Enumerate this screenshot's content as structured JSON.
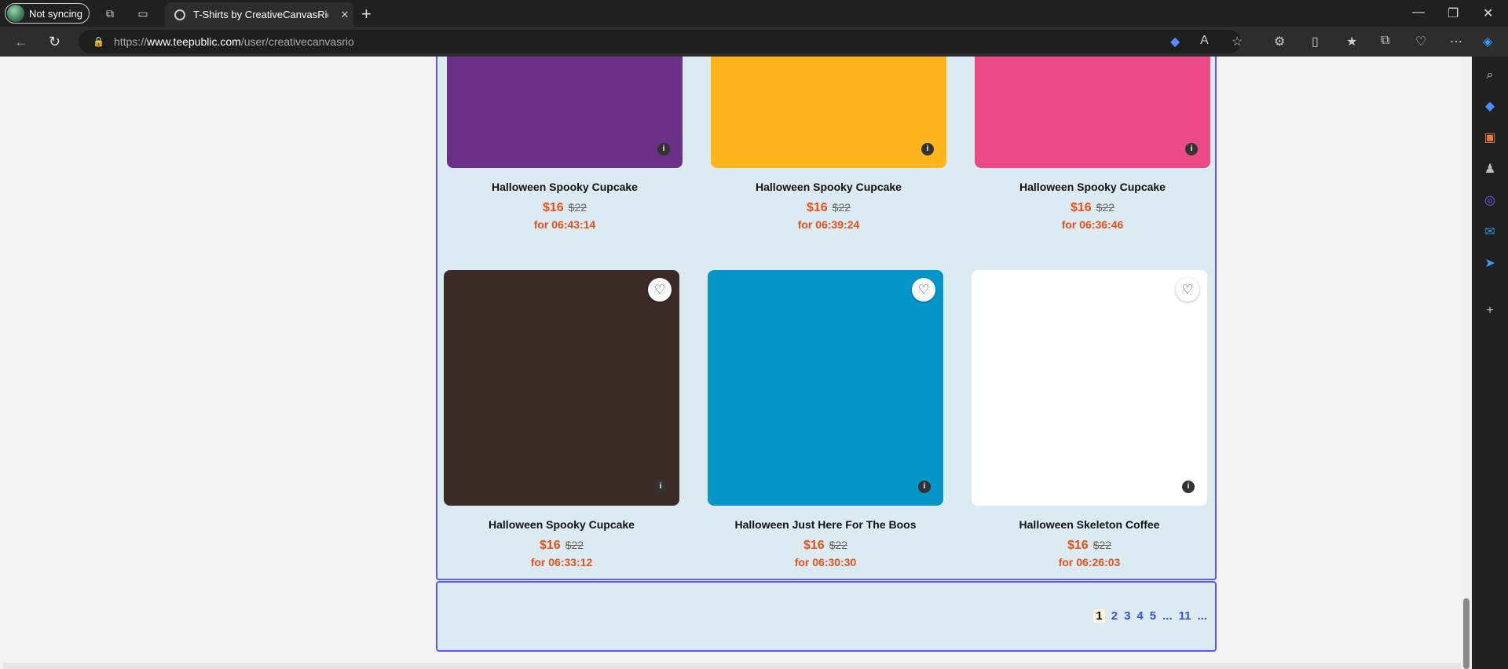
{
  "browser": {
    "profile_label": "Not syncing",
    "tab_title": "T-Shirts by CreativeCanvasRio | T",
    "url_prefix": "https://",
    "url_host": "www.teepublic.com",
    "url_path": "/user/creativecanvasrio"
  },
  "products": [
    {
      "title": "Halloween Spooky Cupcake",
      "price": "$16",
      "old_price": "$22",
      "timer": "for 06:43:14",
      "bg": "#6a2f86"
    },
    {
      "title": "Halloween Spooky Cupcake",
      "price": "$16",
      "old_price": "$22",
      "timer": "for 06:39:24",
      "bg": "#fdb51d"
    },
    {
      "title": "Halloween Spooky Cupcake",
      "price": "$16",
      "old_price": "$22",
      "timer": "for 06:36:46",
      "bg": "#ec4a86"
    },
    {
      "title": "Halloween Spooky Cupcake",
      "price": "$16",
      "old_price": "$22",
      "timer": "for 06:33:12",
      "bg": "#3b2b26"
    },
    {
      "title": "Halloween Just Here For The Boos",
      "price": "$16",
      "old_price": "$22",
      "timer": "for 06:30:30",
      "bg": "#0496c8"
    },
    {
      "title": "Halloween Skeleton Coffee",
      "price": "$16",
      "old_price": "$22",
      "timer": "for 06:26:03",
      "bg": "#ffffff"
    }
  ],
  "pagination": [
    "1",
    "2",
    "3",
    "4",
    "5",
    "...",
    "11",
    "..."
  ],
  "colors": {
    "accent": "#5b5bf5",
    "price": "#e8501a",
    "link": "#3a4fd6"
  }
}
